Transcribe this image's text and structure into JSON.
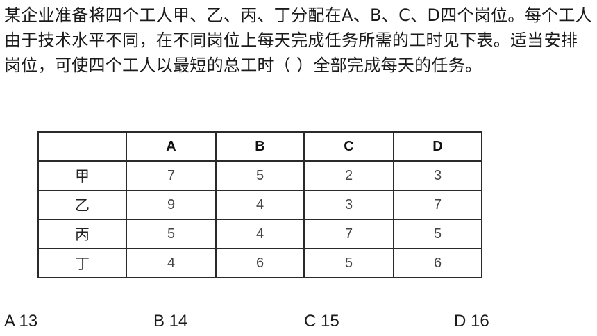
{
  "question": {
    "text": "某企业准备将四个工人甲、乙、丙、丁分配在A、B、C、D四个岗位。每个工人由于技术水平不同，在不同岗位上每天完成任务所需的工时见下表。适当安排岗位，可使四个工人以最短的总工时（ ）全部完成每天的任务。"
  },
  "table": {
    "corner": "",
    "columns": [
      "A",
      "B",
      "C",
      "D"
    ],
    "rows": [
      {
        "worker": "甲",
        "values": [
          "7",
          "5",
          "2",
          "3"
        ]
      },
      {
        "worker": "乙",
        "values": [
          "9",
          "4",
          "3",
          "7"
        ]
      },
      {
        "worker": "丙",
        "values": [
          "5",
          "4",
          "7",
          "5"
        ]
      },
      {
        "worker": "丁",
        "values": [
          "4",
          "6",
          "5",
          "6"
        ]
      }
    ]
  },
  "options": [
    {
      "label": "A 13"
    },
    {
      "label": "B 14"
    },
    {
      "label": "C 15"
    },
    {
      "label": "D 16"
    }
  ]
}
